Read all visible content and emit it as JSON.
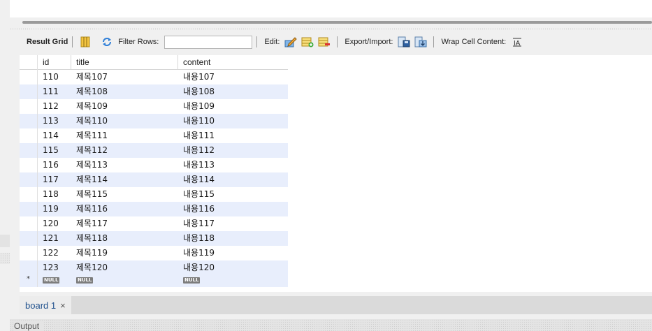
{
  "toolbar": {
    "result_grid_label": "Result Grid",
    "filter_rows_label": "Filter Rows:",
    "filter_value": "",
    "edit_label": "Edit:",
    "export_import_label": "Export/Import:",
    "wrap_cell_label": "Wrap Cell Content:",
    "icons": [
      "grid-layout-icon",
      "refresh-icon",
      "edit-pencil-icon",
      "add-row-icon",
      "delete-row-icon",
      "export-icon",
      "import-icon",
      "wrap-text-icon"
    ]
  },
  "grid": {
    "columns": [
      "id",
      "title",
      "content"
    ],
    "rows": [
      [
        "110",
        "제목107",
        "내용107"
      ],
      [
        "111",
        "제목108",
        "내용108"
      ],
      [
        "112",
        "제목109",
        "내용109"
      ],
      [
        "113",
        "제목110",
        "내용110"
      ],
      [
        "114",
        "제목111",
        "내용111"
      ],
      [
        "115",
        "제목112",
        "내용112"
      ],
      [
        "116",
        "제목113",
        "내용113"
      ],
      [
        "117",
        "제목114",
        "내용114"
      ],
      [
        "118",
        "제목115",
        "내용115"
      ],
      [
        "119",
        "제목116",
        "내용116"
      ],
      [
        "120",
        "제목117",
        "내용117"
      ],
      [
        "121",
        "제목118",
        "내용118"
      ],
      [
        "122",
        "제목119",
        "내용119"
      ],
      [
        "123",
        "제목120",
        "내용120"
      ]
    ],
    "null_label": "NULL",
    "new_row_marker": "*"
  },
  "tabs": [
    {
      "label": "board 1",
      "close": "×"
    }
  ],
  "output": {
    "label": "Output"
  },
  "colors": {
    "alt_row": "#e8eefc",
    "tab_text": "#1d4f8c",
    "null_badge": "#7d7d7d"
  }
}
